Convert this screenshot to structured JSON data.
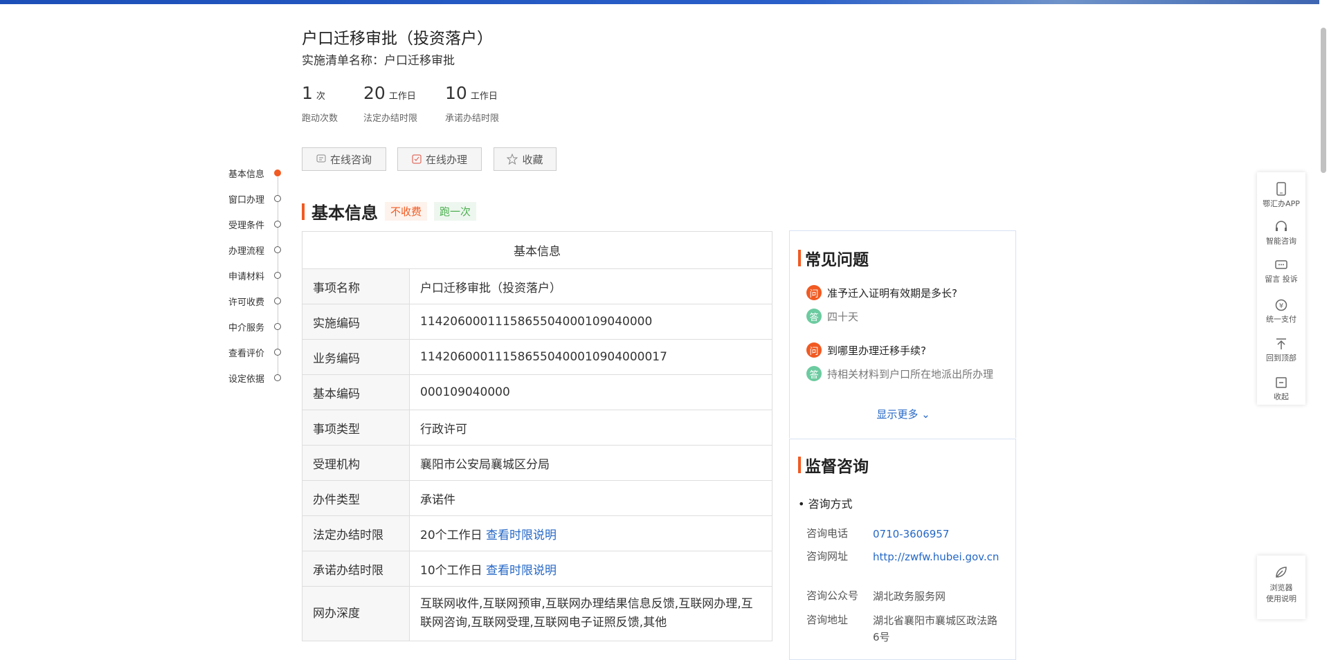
{
  "header": {
    "title": "户口迁移审批（投资落户）",
    "subtitle": "实施清单名称：户口迁移审批"
  },
  "stats": [
    {
      "num": "1",
      "unit": "次",
      "label": "跑动次数"
    },
    {
      "num": "20",
      "unit": "工作日",
      "label": "法定办结时限"
    },
    {
      "num": "10",
      "unit": "工作日",
      "label": "承诺办结时限"
    }
  ],
  "actions": {
    "consult": "在线咨询",
    "handle": "在线办理",
    "favorite": "收藏"
  },
  "nav": [
    "基本信息",
    "窗口办理",
    "受理条件",
    "办理流程",
    "申请材料",
    "许可收费",
    "中介服务",
    "查看评价",
    "设定依据"
  ],
  "section": {
    "title": "基本信息",
    "tag_fee": "不收费",
    "tag_run": "跑一次"
  },
  "table": {
    "header": "基本信息",
    "rows": [
      {
        "k": "事项名称",
        "v": "户口迁移审批（投资落户）"
      },
      {
        "k": "实施编码",
        "v": "11420600011158655040001090400​00"
      },
      {
        "k": "业务编码",
        "v": "11420600011158655040001090400​0017"
      },
      {
        "k": "基本编码",
        "v": "000109040000"
      },
      {
        "k": "事项类型",
        "v": "行政许可"
      },
      {
        "k": "受理机构",
        "v": "襄阳市公安局襄城区分局"
      },
      {
        "k": "办件类型",
        "v": "承诺件"
      },
      {
        "k": "法定办结时限",
        "v": "20个工作日",
        "link": "查看时限说明"
      },
      {
        "k": "承诺办结时限",
        "v": "10个工作日",
        "link": "查看时限说明"
      },
      {
        "k": "网办深度",
        "v": "互联网收件,互联网预审,互联网办理结果信息反馈,互联网办理,互联网咨询,互联网受理,互联网电子证照反馈,其他"
      }
    ]
  },
  "faq": {
    "title": "常见问题",
    "items": [
      {
        "q": "准予迁入证明有效期是多长?",
        "a": "四十天"
      },
      {
        "q": "到哪里办理迁移手续?",
        "a": "持相关材料到户口所在地派出所办理"
      }
    ],
    "badge_q": "问",
    "badge_a": "答",
    "more": "显示更多"
  },
  "supervise": {
    "title": "监督咨询",
    "way": "• 咨询方式",
    "rows": [
      {
        "k": "咨询电话",
        "v": "0710-3606957"
      },
      {
        "k": "咨询网址",
        "v": "http://zwfw.hubei.gov.cn"
      },
      {
        "k": "咨询公众号",
        "v": "湖北政务服务网"
      },
      {
        "k": "咨询地址",
        "v": "湖北省襄阳市襄城区政法路6号"
      }
    ]
  },
  "tools": [
    "鄂汇办APP",
    "智能咨询",
    "留言 投诉",
    "统一支付",
    "回到顶部",
    "收起"
  ],
  "browser_help": [
    "浏览器",
    "使用说明"
  ]
}
